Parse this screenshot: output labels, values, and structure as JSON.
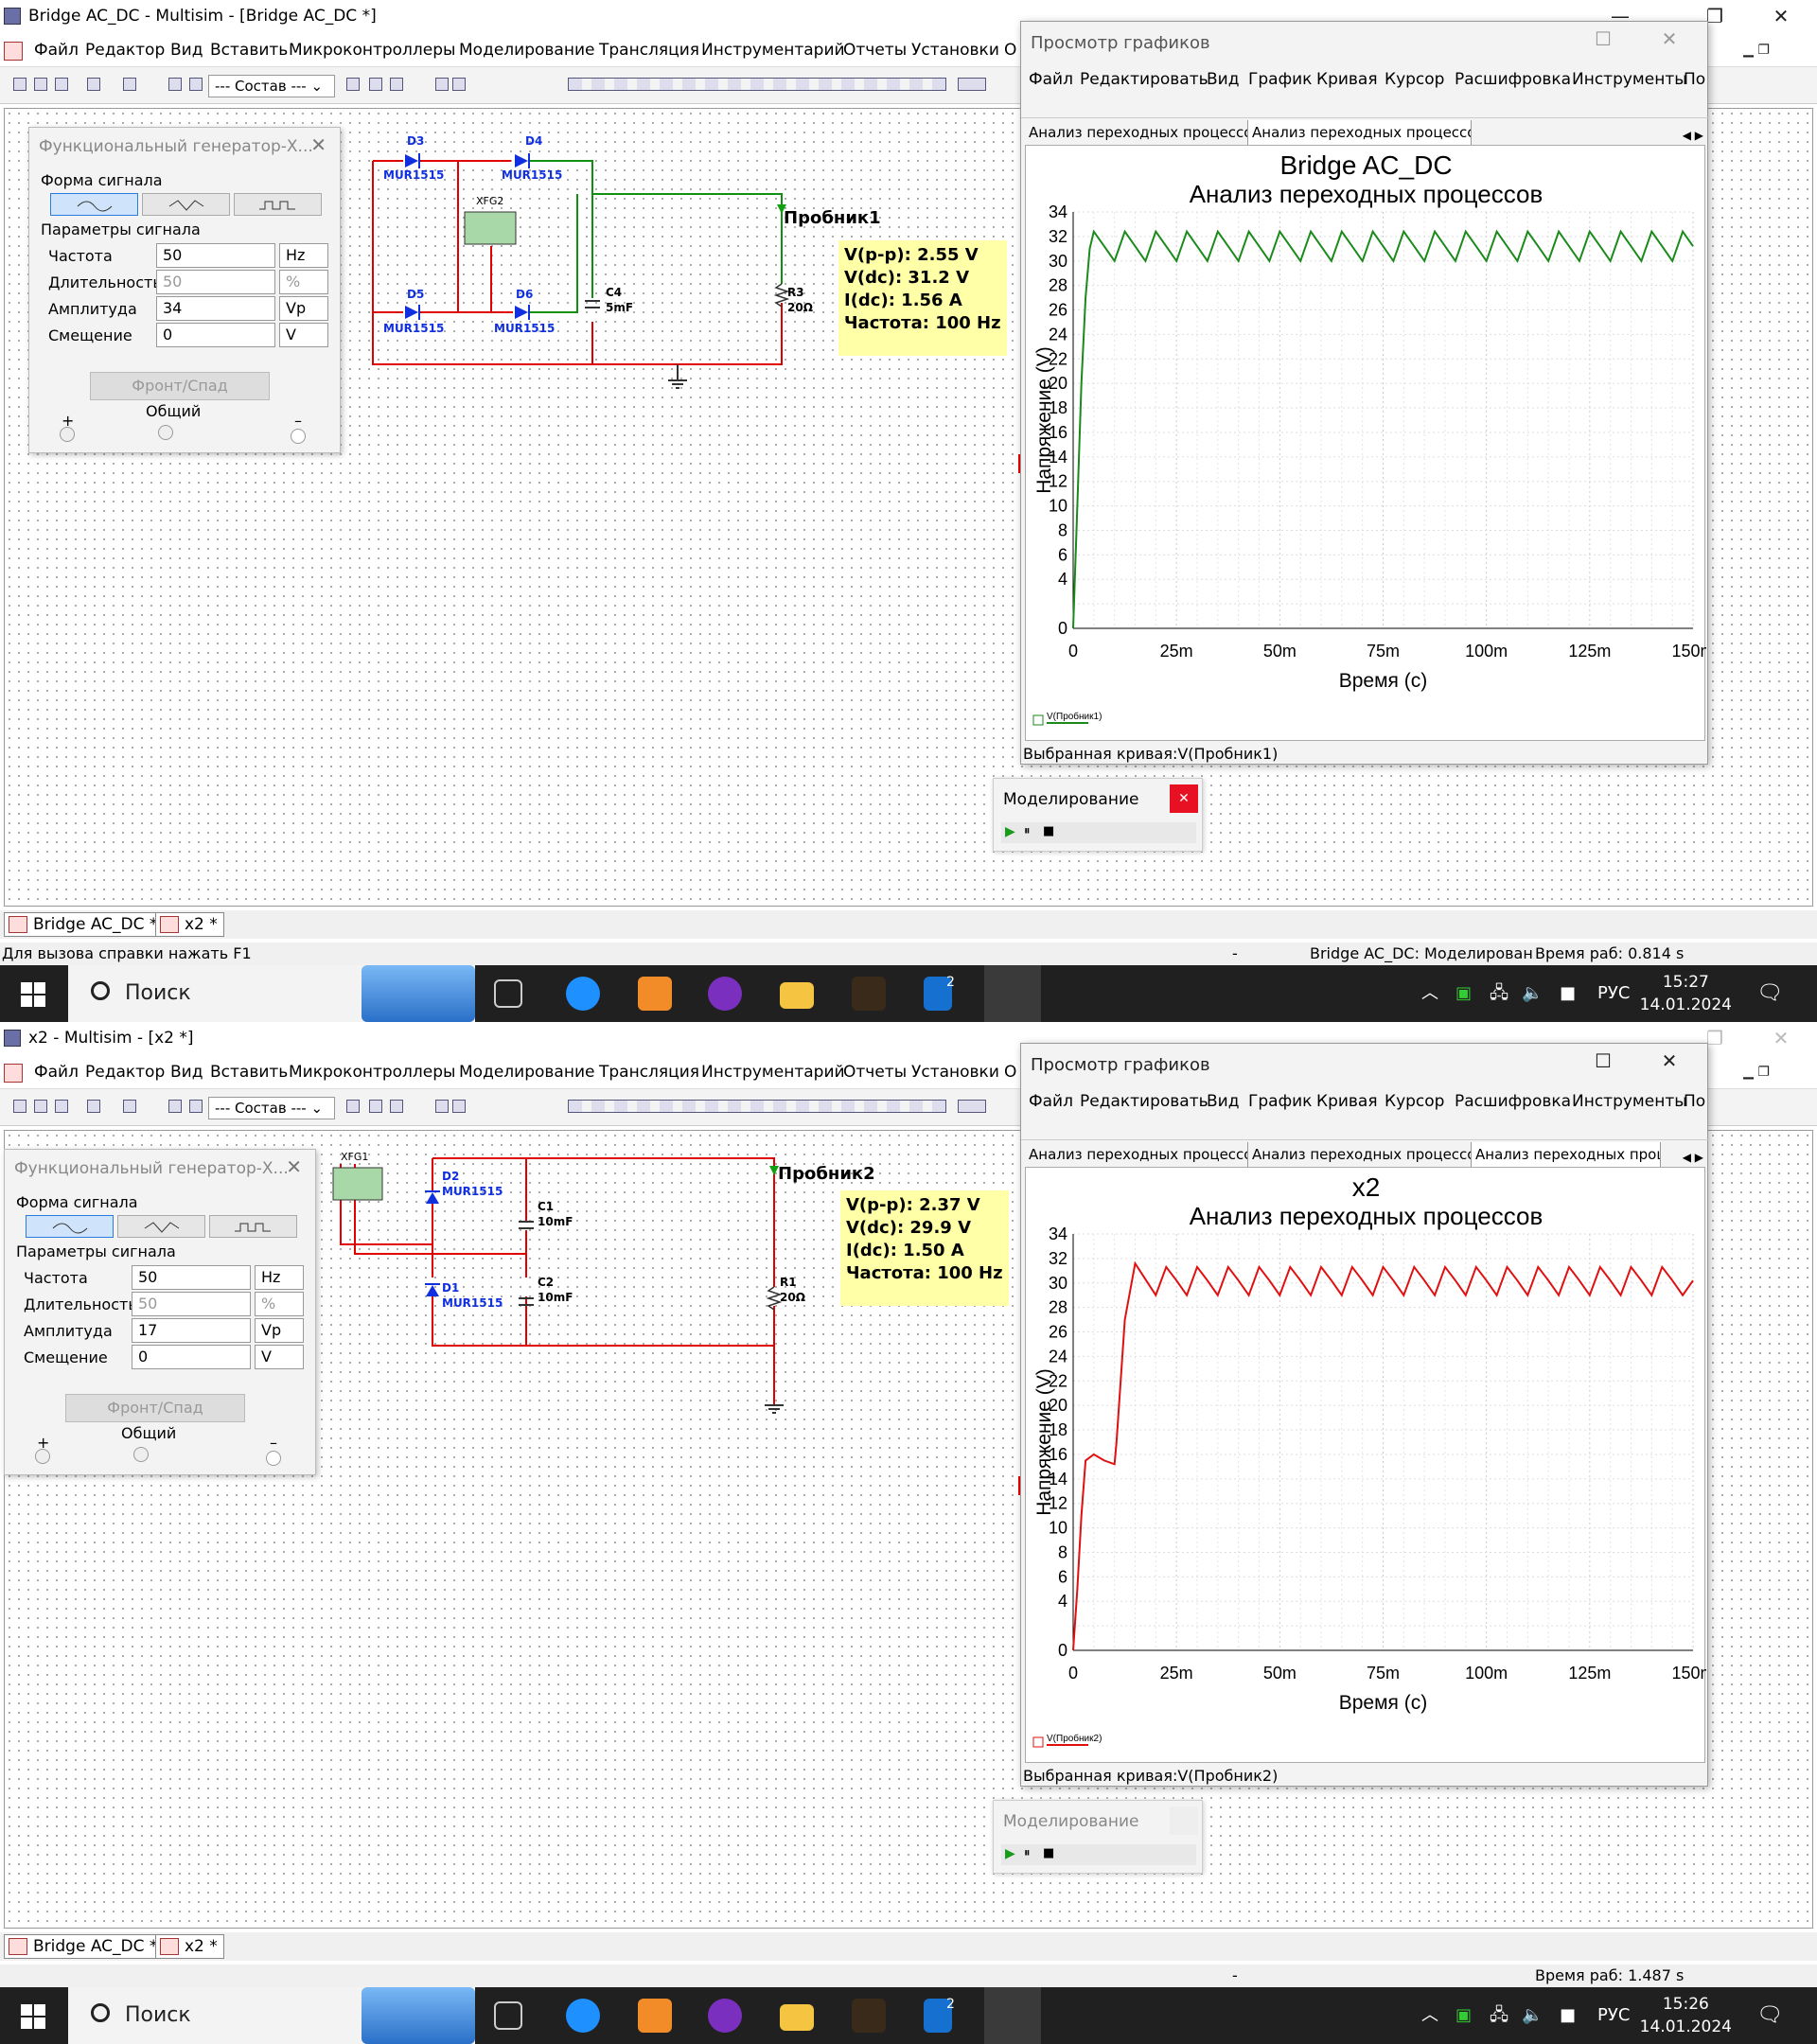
{
  "top": {
    "window_title": "Bridge AC_DC - Multisim - [Bridge AC_DC *]",
    "fgen_title": "Функциональный генератор-X...",
    "fgen_amplitude": "34",
    "schematic": {
      "d3": "D3",
      "d4": "D4",
      "d5": "D5",
      "d6": "D6",
      "part": "MUR1515",
      "xfg": "XFG2",
      "cap": "C4",
      "cap_val": "5mF",
      "res": "R3",
      "res_val": "20Ω",
      "probe": "Пробник1"
    },
    "probe": {
      "vpp": "V(p-p): 2.55 V",
      "vdc": "V(dc): 31.2 V",
      "idc": "I(dc): 1.56 A",
      "freq": "Частота: 100 Hz"
    },
    "graph": {
      "title": "Просмотр графиков",
      "tabs": [
        "Анализ переходных процессов",
        "Анализ переходных процессов"
      ],
      "plot_title": "Bridge AC_DC",
      "plot_subtitle": "Анализ переходных процессов",
      "legend": "V(Пробник1)",
      "selected": "Выбранная кривая:V(Пробник1)"
    },
    "sim_title": "Моделирование",
    "status_left": "Для вызова справки нажать F1",
    "status_mid": "-",
    "status_center": "Bridge AC_DC: Моделирован",
    "status_right": "Время раб: 0.814 s",
    "time": "15:27",
    "date": "14.01.2024"
  },
  "bottom": {
    "window_title": "x2 - Multisim - [x2 *]",
    "fgen_title": "Функциональный генератор-X...",
    "fgen_amplitude": "17",
    "schematic": {
      "d2": "D2",
      "d1": "D1",
      "part": "MUR1515",
      "xfg": "XFG1",
      "c1": "C1",
      "c2": "C2",
      "cap_val": "10mF",
      "res": "R1",
      "res_val": "20Ω",
      "probe": "Пробник2"
    },
    "probe": {
      "vpp": "V(p-p): 2.37 V",
      "vdc": "V(dc): 29.9 V",
      "idc": "I(dc): 1.50 A",
      "freq": "Частота: 100 Hz"
    },
    "graph": {
      "title": "Просмотр графиков",
      "tabs": [
        "Анализ переходных процессов",
        "Анализ переходных процессов",
        "Анализ переходных проце"
      ],
      "plot_title": "x2",
      "plot_subtitle": "Анализ переходных процессов",
      "legend": "V(Пробник2)",
      "selected": "Выбранная кривая:V(Пробник2)"
    },
    "sim_title": "Моделирование",
    "status_mid": "-",
    "status_right": "Время раб: 1.487 s",
    "time": "15:26",
    "date": "14.01.2024"
  },
  "common": {
    "menu": [
      "Файл",
      "Редактор",
      "Вид",
      "Вставить",
      "Микроконтроллеры",
      "Моделирование",
      "Трансляция",
      "Инструментарий",
      "Отчеты",
      "Установки",
      "О"
    ],
    "combo": "--- Состав ---",
    "graph_menu": [
      "Файл",
      "Редактировать",
      "Вид",
      "График",
      "Кривая",
      "Курсор",
      "Расшифровка",
      "Инструменты",
      "По"
    ],
    "fgen": {
      "waveform": "Форма сигнала",
      "params": "Параметры сигнала",
      "freq_label": "Частота",
      "freq": "50",
      "freq_unit": "Hz",
      "duty_label": "Длительность",
      "duty": "50",
      "duty_unit": "%",
      "amp_label": "Амплитуда",
      "amp_unit": "Vp",
      "offset_label": "Смещение",
      "offset": "0",
      "offset_unit": "V",
      "edge_btn": "Фронт/Спад",
      "plus": "+",
      "common": "Общий",
      "minus": "–"
    },
    "doc_tabs": [
      "Bridge AC_DC *",
      "x2 *"
    ],
    "search": "Поиск",
    "lang": "РУС",
    "badge": "2"
  },
  "chart_data": [
    {
      "type": "line",
      "title": "Bridge AC_DC",
      "subtitle": "Анализ переходных процессов",
      "xlabel": "Время (с)",
      "ylabel": "Напряжение (V)",
      "xlim": [
        0,
        0.15
      ],
      "ylim": [
        0,
        34
      ],
      "grid": true,
      "xticks": [
        "0",
        "25m",
        "50m",
        "75m",
        "100m",
        "125m",
        "150m"
      ],
      "yticks": [
        "0",
        "4",
        "6",
        "8",
        "10",
        "12",
        "14",
        "16",
        "18",
        "20",
        "22",
        "24",
        "26",
        "28",
        "30",
        "32",
        "34"
      ],
      "series": [
        {
          "name": "V(Пробник1)",
          "color": "#1a8a1a",
          "x": [
            0,
            0.001,
            0.002,
            0.003,
            0.004,
            0.005,
            0.0075,
            0.01,
            0.0125,
            0.015,
            0.0175,
            0.02,
            0.0225,
            0.025,
            0.0275,
            0.03,
            0.0325,
            0.035,
            0.0375,
            0.04,
            0.0425,
            0.045,
            0.0475,
            0.05,
            0.0525,
            0.055,
            0.0575,
            0.06,
            0.0625,
            0.065,
            0.0675,
            0.07,
            0.0725,
            0.075,
            0.0775,
            0.08,
            0.0825,
            0.085,
            0.0875,
            0.09,
            0.0925,
            0.095,
            0.0975,
            0.1,
            0.1025,
            0.105,
            0.1075,
            0.11,
            0.1125,
            0.115,
            0.1175,
            0.12,
            0.1225,
            0.125,
            0.1275,
            0.13,
            0.1325,
            0.135,
            0.1375,
            0.14,
            0.1425,
            0.145,
            0.1475,
            0.15
          ],
          "y": [
            0,
            10,
            20,
            27,
            31,
            32.4,
            31.2,
            30,
            32.4,
            31.2,
            30,
            32.4,
            31.2,
            30,
            32.4,
            31.2,
            30,
            32.4,
            31.2,
            30,
            32.4,
            31.2,
            30,
            32.4,
            31.2,
            30,
            32.4,
            31.2,
            30,
            32.4,
            31.2,
            30,
            32.4,
            31.2,
            30,
            32.4,
            31.2,
            30,
            32.4,
            31.2,
            30,
            32.4,
            31.2,
            30,
            32.4,
            31.2,
            30,
            32.4,
            31.2,
            30,
            32.4,
            31.2,
            30,
            32.4,
            31.2,
            30,
            32.4,
            31.2,
            30,
            32.4,
            31.2,
            30,
            32.4,
            31.2
          ]
        }
      ]
    },
    {
      "type": "line",
      "title": "x2",
      "subtitle": "Анализ переходных процессов",
      "xlabel": "Время (с)",
      "ylabel": "Напряжение (V)",
      "xlim": [
        0,
        0.15
      ],
      "ylim": [
        0,
        34
      ],
      "grid": true,
      "xticks": [
        "0",
        "25m",
        "50m",
        "75m",
        "100m",
        "125m",
        "150m"
      ],
      "yticks": [
        "0",
        "4",
        "6",
        "8",
        "10",
        "12",
        "14",
        "16",
        "18",
        "20",
        "22",
        "24",
        "26",
        "28",
        "30",
        "32",
        "34"
      ],
      "series": [
        {
          "name": "V(Пробник2)",
          "color": "#e01010",
          "x": [
            0,
            0.001,
            0.002,
            0.003,
            0.005,
            0.0075,
            0.01,
            0.0105,
            0.0125,
            0.015,
            0.0175,
            0.02,
            0.0225,
            0.025,
            0.0275,
            0.03,
            0.0325,
            0.035,
            0.0375,
            0.04,
            0.0425,
            0.045,
            0.0475,
            0.05,
            0.0525,
            0.055,
            0.0575,
            0.06,
            0.0625,
            0.065,
            0.0675,
            0.07,
            0.0725,
            0.075,
            0.0775,
            0.08,
            0.0825,
            0.085,
            0.0875,
            0.09,
            0.0925,
            0.095,
            0.0975,
            0.1,
            0.1025,
            0.105,
            0.1075,
            0.11,
            0.1125,
            0.115,
            0.1175,
            0.12,
            0.1225,
            0.125,
            0.1275,
            0.13,
            0.1325,
            0.135,
            0.1375,
            0.14,
            0.1425,
            0.145,
            0.1475,
            0.15
          ],
          "y": [
            0,
            5,
            11,
            15.5,
            16,
            15.5,
            15.2,
            17,
            27,
            31.6,
            30.3,
            29,
            31.3,
            30.2,
            29,
            31.3,
            30.2,
            29,
            31.3,
            30.2,
            29,
            31.3,
            30.2,
            29,
            31.3,
            30.2,
            29,
            31.3,
            30.2,
            29,
            31.3,
            30.2,
            29,
            31.3,
            30.2,
            29,
            31.3,
            30.2,
            29,
            31.3,
            30.2,
            29,
            31.3,
            30.2,
            29,
            31.3,
            30.2,
            29,
            31.3,
            30.2,
            29,
            31.3,
            30.2,
            29,
            31.3,
            30.2,
            29,
            31.3,
            30.2,
            29,
            31.3,
            30.2,
            29,
            30.2
          ]
        }
      ]
    }
  ]
}
